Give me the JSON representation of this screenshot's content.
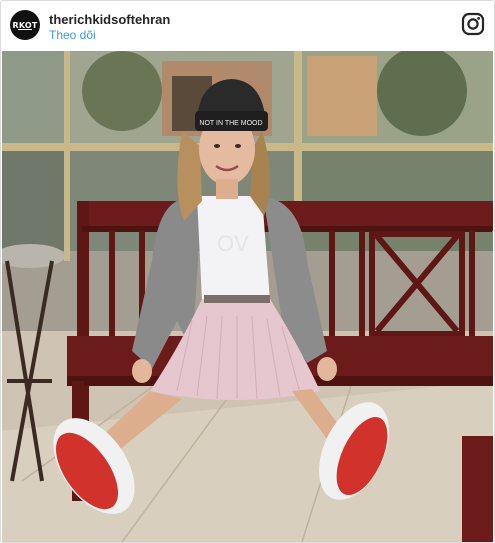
{
  "post": {
    "avatar_text": "RKOT",
    "username": "therichkidsoftehran",
    "follow_label": "Theo dõi",
    "platform_icon": "instagram-icon",
    "photo": {
      "beanie_text": "NOT IN THE MOOD",
      "description_icon": "photo"
    }
  },
  "colors": {
    "link": "#3897f0",
    "username": "#262626",
    "border": "#dbdbdb",
    "bench": "#6b1c1a",
    "sole": "#d2322c"
  }
}
